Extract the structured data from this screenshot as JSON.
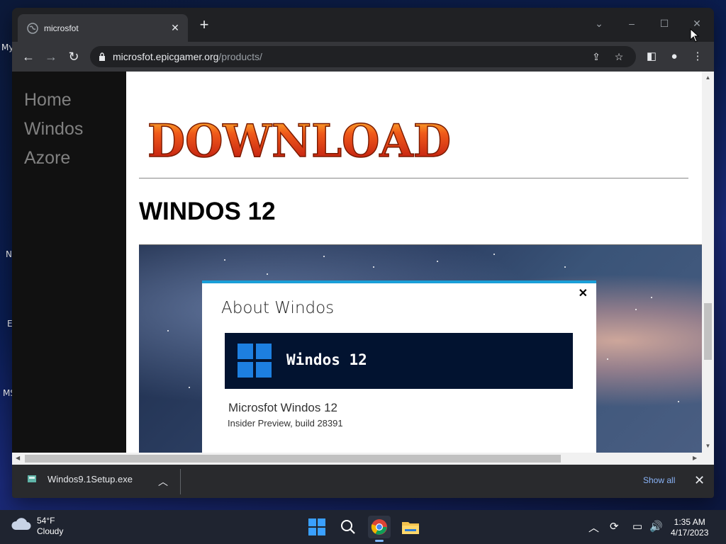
{
  "desktop": {
    "labels": [
      "My",
      "N",
      "E",
      "MS"
    ]
  },
  "browser": {
    "tab": {
      "title": "microsfot"
    },
    "address": {
      "domain": "microsfot.epicgamer.org",
      "path": "/products/"
    }
  },
  "page": {
    "nav": [
      "Home",
      "Windos",
      "Azore"
    ],
    "banner_text": "DOWNLOAD",
    "heading": "WINDOS 12",
    "dialog": {
      "title": "About Windos",
      "close": "✕",
      "brand": "Windos 12",
      "product": "Microsfot Windos 12",
      "build": "Insider Preview, build 28391"
    }
  },
  "download_bar": {
    "file": "Windos9.1Setup.exe",
    "show_all": "Show all"
  },
  "taskbar": {
    "weather": {
      "temp": "54°F",
      "condition": "Cloudy"
    },
    "time": "1:35 AM",
    "date": "4/17/2023"
  },
  "colors": {
    "accent": "#1a9fd8",
    "sidebar_bg": "#111111",
    "link_blue": "#8ab4f8"
  }
}
